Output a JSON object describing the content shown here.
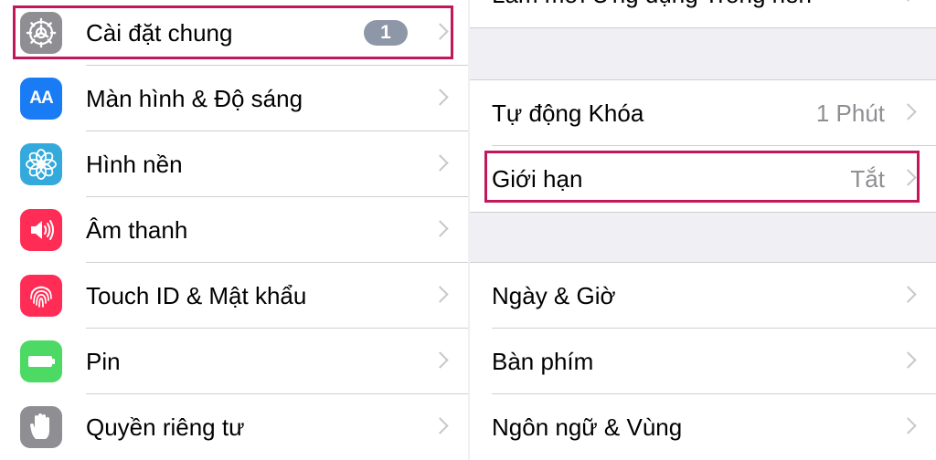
{
  "left": {
    "items": [
      {
        "label": "Cài đặt chung",
        "badge": "1"
      },
      {
        "label": "Màn hình & Độ sáng",
        "icon_text": "AA"
      },
      {
        "label": "Hình nền"
      },
      {
        "label": "Âm thanh"
      },
      {
        "label": "Touch ID & Mật khẩu"
      },
      {
        "label": "Pin"
      },
      {
        "label": "Quyền riêng tư"
      }
    ],
    "icons": [
      "gear-icon",
      "text-size-icon",
      "flower-icon",
      "speaker-icon",
      "fingerprint-icon",
      "battery-icon",
      "hand-icon"
    ]
  },
  "right": {
    "top_partial": {
      "label": "Làm mới Ứng dụng Trong nền"
    },
    "auto_lock": {
      "label": "Tự động Khóa",
      "value": "1 Phút"
    },
    "restrictions": {
      "label": "Giới hạn",
      "value": "Tắt"
    },
    "date_time": {
      "label": "Ngày & Giờ"
    },
    "keyboard": {
      "label": "Bàn phím"
    },
    "language_region": {
      "label": "Ngôn ngữ & Vùng"
    }
  },
  "colors": {
    "highlight": "#c2185b",
    "general_icon": "#8e8e93",
    "display_icon": "#1a7cf5",
    "wallpaper_icon": "#34aadc",
    "sounds_icon": "#ff2d55",
    "touchid_icon": "#ff2d55",
    "battery_icon": "#4cd964",
    "privacy_icon": "#8e8e93",
    "badge": "#8e97a8"
  }
}
